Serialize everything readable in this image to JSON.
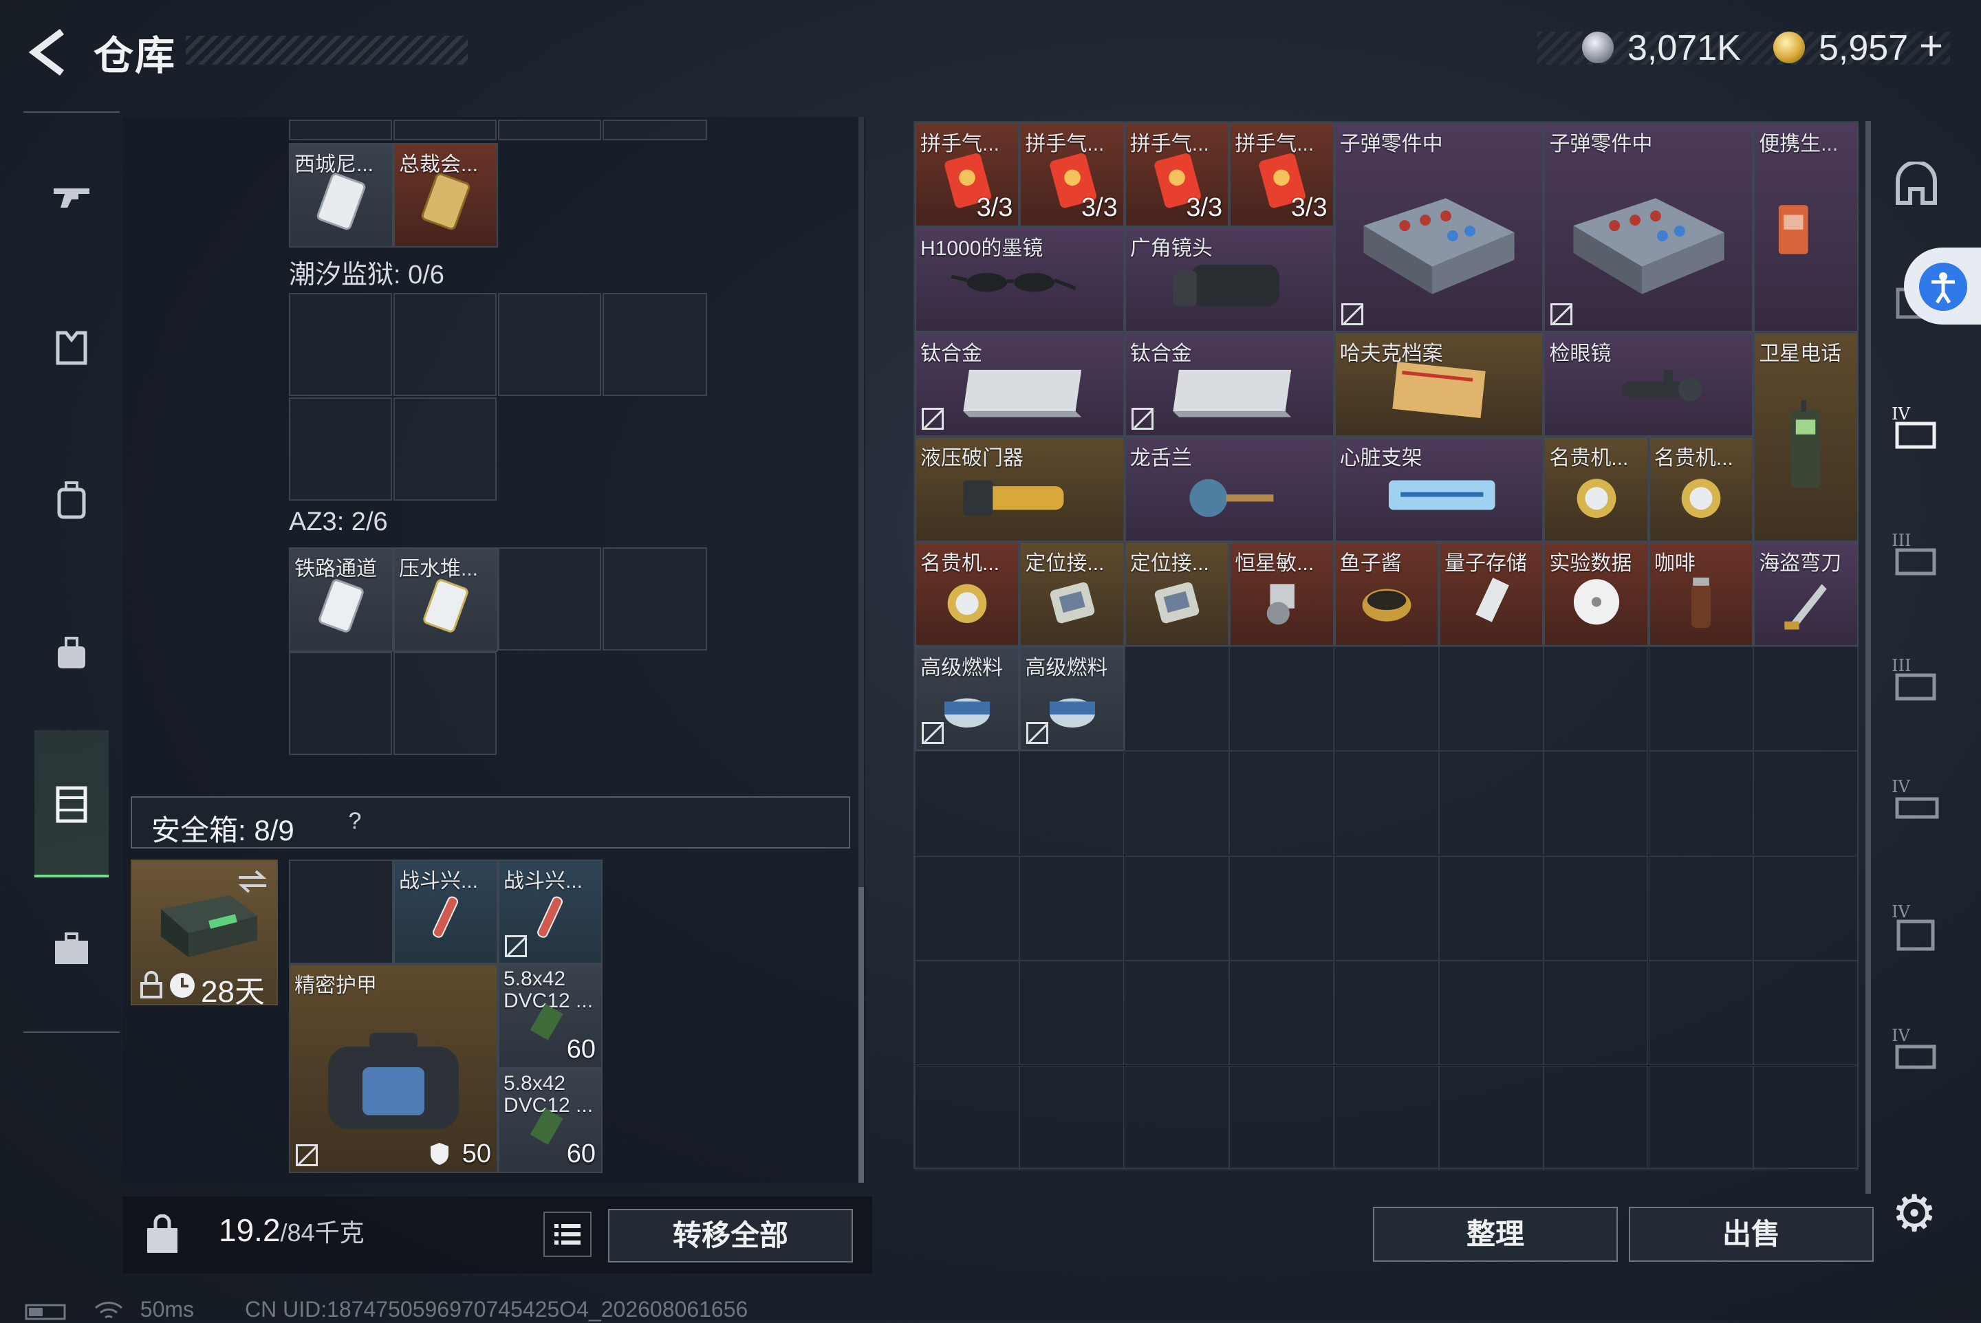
{
  "header": {
    "title": "仓库",
    "currency1": "3,071K",
    "currency2": "5,957",
    "currency2_add": "+"
  },
  "left_nav": {
    "items": [
      "gun-icon",
      "armor-icon",
      "backpack-icon",
      "bag-icon",
      "safebox-icon",
      "briefcase-icon"
    ],
    "active": "safebox-icon"
  },
  "containers": {
    "top_items": [
      {
        "label": "西城尼..."
      },
      {
        "label": "总裁会..."
      }
    ],
    "tide_prison": "潮汐监狱: 0/6",
    "az3": "AZ3: 2/6",
    "az3_items": [
      {
        "label": "铁路通道"
      },
      {
        "label": "压水堆..."
      }
    ]
  },
  "safebox": {
    "label": "安全箱: 8/9",
    "help": "?",
    "timer": "28天",
    "items": [
      {
        "label": "战斗兴..."
      },
      {
        "label": "战斗兴..."
      },
      {
        "label": "精密护甲",
        "durability": "50"
      },
      {
        "label": "5.8x42 DVC12 ...",
        "count": "60"
      },
      {
        "label": "5.8x42 DVC12 ...",
        "count": "60"
      }
    ]
  },
  "bottom_left": {
    "weight": "19.2",
    "weight_max": "/84千克",
    "transfer_label": "转移全部"
  },
  "stash": {
    "items": [
      {
        "label": "拼手气...",
        "count": "3/3"
      },
      {
        "label": "拼手气...",
        "count": "3/3"
      },
      {
        "label": "拼手气...",
        "count": "3/3"
      },
      {
        "label": "拼手气...",
        "count": "3/3"
      },
      {
        "label": "子弹零件中"
      },
      {
        "label": "子弹零件中"
      },
      {
        "label": "便携生..."
      },
      {
        "label": "H1000的墨镜"
      },
      {
        "label": "广角镜头"
      },
      {
        "label": "钛合金"
      },
      {
        "label": "钛合金"
      },
      {
        "label": "哈夫克档案"
      },
      {
        "label": "检眼镜"
      },
      {
        "label": "卫星电话"
      },
      {
        "label": "液压破门器"
      },
      {
        "label": "龙舌兰"
      },
      {
        "label": "心脏支架"
      },
      {
        "label": "名贵机..."
      },
      {
        "label": "名贵机..."
      },
      {
        "label": "名贵机..."
      },
      {
        "label": "定位接..."
      },
      {
        "label": "定位接..."
      },
      {
        "label": "恒星敏..."
      },
      {
        "label": "鱼子酱"
      },
      {
        "label": "量子存储"
      },
      {
        "label": "实验数据"
      },
      {
        "label": "咖啡"
      },
      {
        "label": "海盗弯刀"
      },
      {
        "label": "高级燃料"
      },
      {
        "label": "高级燃料"
      }
    ],
    "sort_label": "整理",
    "sell_label": "出售"
  },
  "right_nav": {
    "items": [
      "home-icon",
      "case-iv-icon",
      "case-iv-2-icon",
      "case-iii-icon",
      "case-iii-2-icon",
      "case-iv-3-icon",
      "case-iv-4-icon",
      "case-iv-5-icon"
    ]
  },
  "status": {
    "ping": "50ms",
    "uid": "CN UID:1874750596970745425O4_202608061656"
  }
}
